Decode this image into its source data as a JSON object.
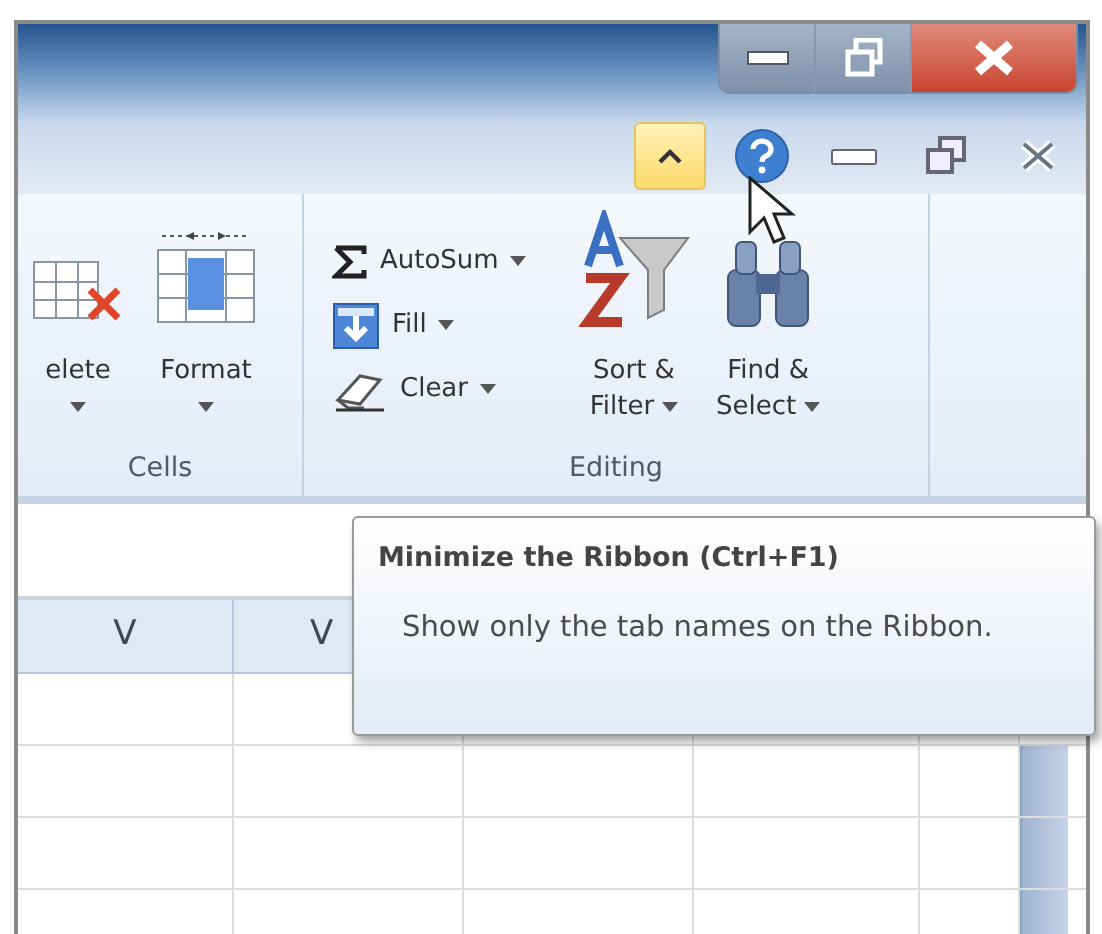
{
  "window_controls": [
    {
      "kind": "minimize"
    },
    {
      "kind": "restore"
    },
    {
      "kind": "close"
    }
  ],
  "ribbon_controls": [
    {
      "kind": "minimize_ribbon",
      "hovered": true
    },
    {
      "kind": "help",
      "hovered": false
    },
    {
      "kind": "minimize",
      "hovered": false
    },
    {
      "kind": "restore",
      "hovered": false
    },
    {
      "kind": "close",
      "hovered": false
    }
  ],
  "ribbon": {
    "groups": [
      {
        "label": "Cells",
        "large": [
          {
            "kind": "delete",
            "lines": [
              "elete"
            ],
            "dropdown": true
          },
          {
            "kind": "format",
            "lines": [
              "Format"
            ],
            "dropdown": true
          }
        ]
      },
      {
        "label": "Editing",
        "small": [
          {
            "kind": "autosum",
            "label": "AutoSum",
            "dropdown": true
          },
          {
            "kind": "fill",
            "label": "Fill",
            "dropdown": true
          },
          {
            "kind": "clear",
            "label": "Clear",
            "dropdown": true
          }
        ],
        "large": [
          {
            "kind": "sort",
            "lines": [
              "Sort &",
              "Filter"
            ],
            "dropdown": true
          },
          {
            "kind": "find",
            "lines": [
              "Find &",
              "Select"
            ],
            "dropdown": true
          }
        ]
      }
    ]
  },
  "grid": {
    "columns": [
      {
        "header": "V"
      },
      {
        "header": "V"
      }
    ]
  },
  "tooltip": {
    "title": "Minimize the Ribbon (Ctrl+F1)",
    "text": "Show only the tab names on the Ribbon."
  }
}
